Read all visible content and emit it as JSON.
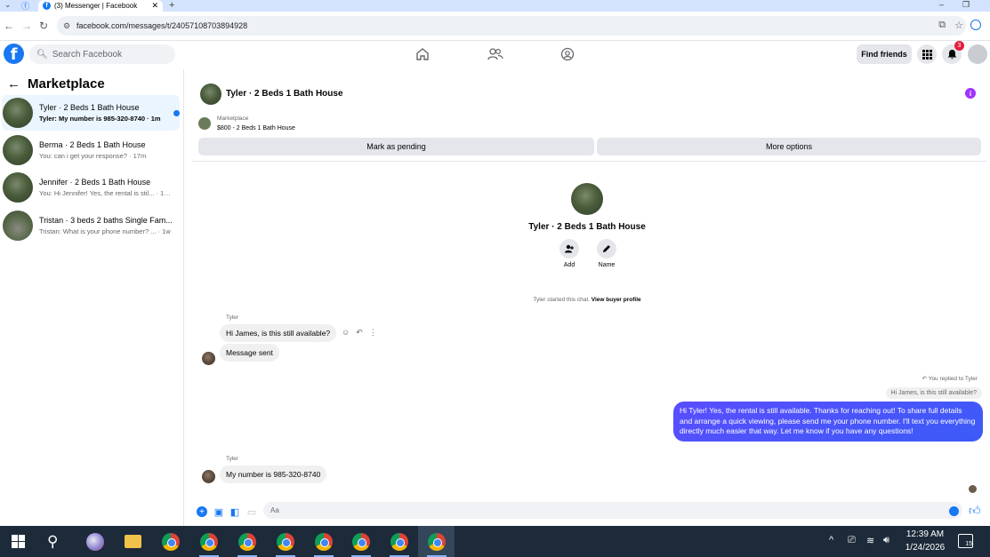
{
  "browser": {
    "tab_title": "(3) Messenger | Facebook",
    "url": "facebook.com/messages/t/24057108703894928"
  },
  "fb_header": {
    "logo_letter": "f",
    "search_placeholder": "Search Facebook",
    "find_friends": "Find friends",
    "notification_count": "3"
  },
  "sidebar": {
    "title": "Marketplace",
    "conversations": [
      {
        "name": "Tyler · 2 Beds 1 Bath House",
        "preview": "Tyler: My number is 985-320-8740 · 1m",
        "unread": true
      },
      {
        "name": "Berma · 2 Beds 1 Bath House",
        "preview": "You: can i get your response? · 17m",
        "unread": false
      },
      {
        "name": "Jennifer · 2 Beds 1 Bath House",
        "preview": "You: Hi Jennifer! Yes, the rental is stil... · 18m",
        "unread": false
      },
      {
        "name": "Tristan · 3 beds 2 baths Single Fam...",
        "preview": "Tristan: What is your phone number? ... · 1w",
        "unread": false
      }
    ]
  },
  "chat": {
    "title": "Tyler · 2 Beds 1 Bath House",
    "listing_source": "Marketplace",
    "listing_price": "$800 - 2 Beds 1 Bath House",
    "mark_pending": "Mark as pending",
    "more_options": "More options",
    "profile_name": "Tyler · 2 Beds 1 Bath House",
    "add_label": "Add",
    "name_label": "Name",
    "started_text": "Tyler started this chat.",
    "view_buyer_profile": "View buyer profile",
    "messages": {
      "m1_sender": "Tyler",
      "m1_text": "Hi James, is this still available?",
      "m2_text": "Message sent",
      "replied_label": "You replied to Tyler",
      "quoted_text": "Hi James, is this still available?",
      "my_reply": "Hi Tyler! Yes, the rental is still available. Thanks for reaching out! To share full details and arrange a quick viewing, please send me your phone number. I'll text you everything directly much easier that way. Let me know if you have any questions!",
      "m3_sender": "Tyler",
      "m3_text": "My number is 985-320-8740"
    },
    "composer_placeholder": "Aa"
  },
  "taskbar": {
    "time": "12:39 AM",
    "date": "1/24/2026",
    "notification_count": "15"
  }
}
